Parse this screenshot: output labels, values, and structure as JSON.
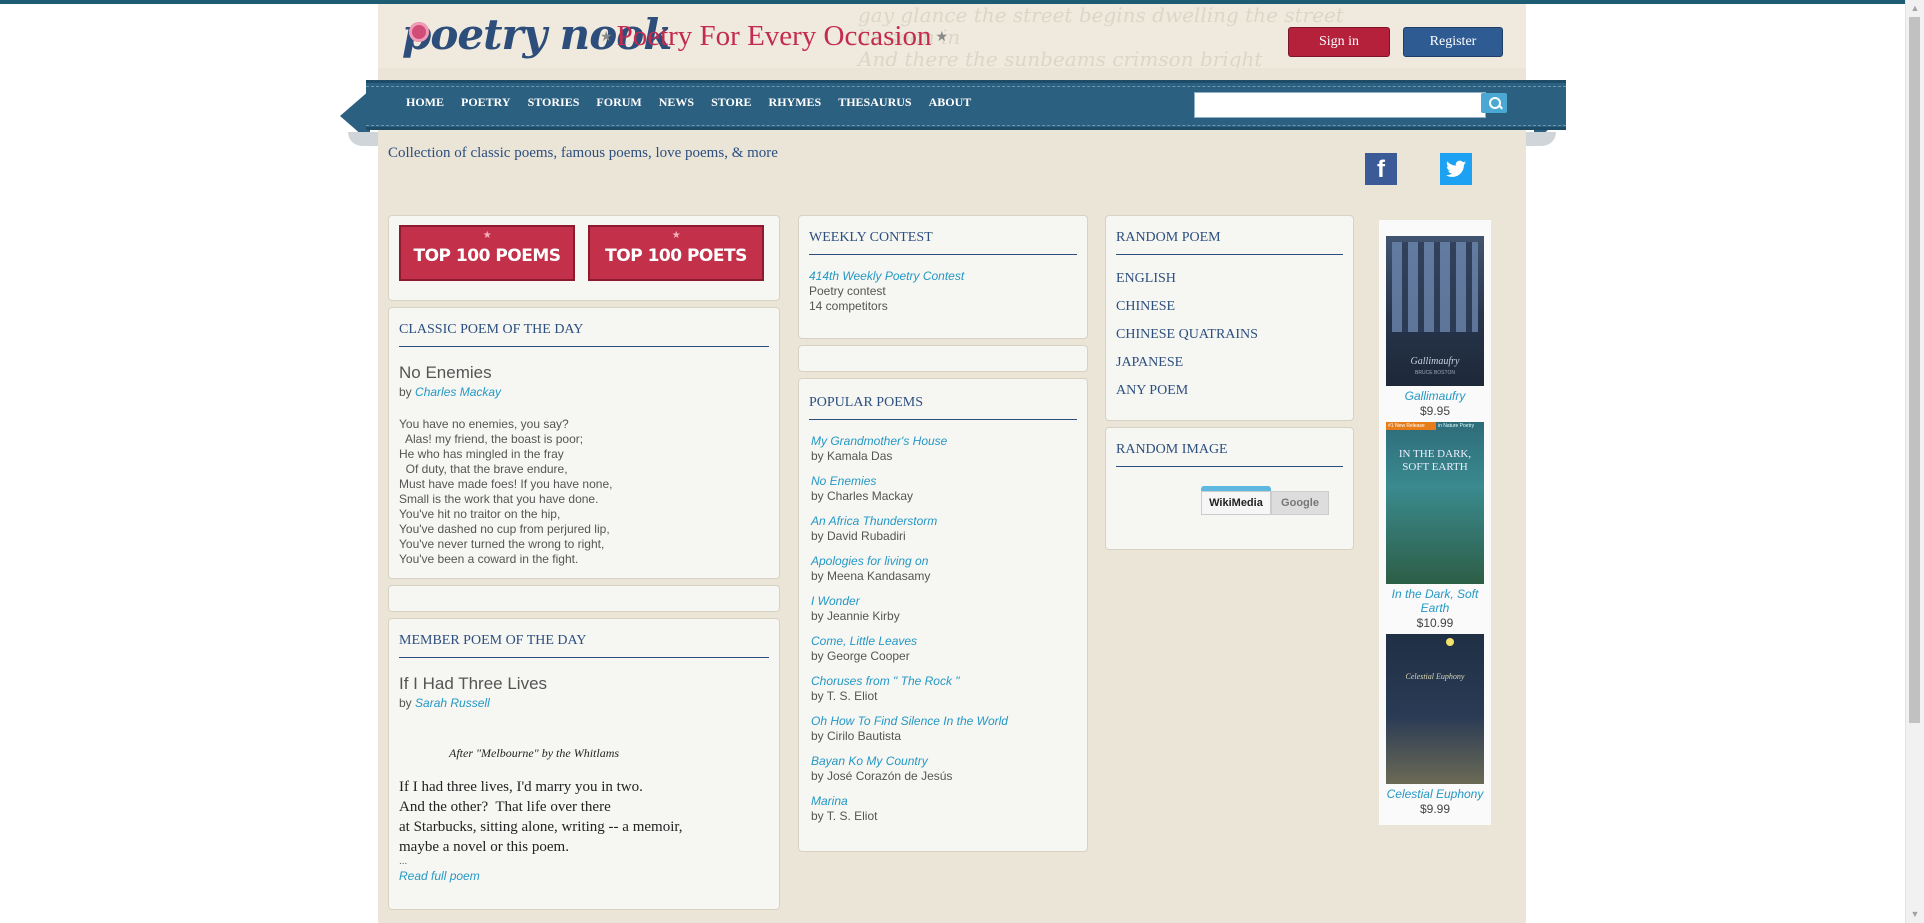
{
  "header": {
    "logo": "poetry nook",
    "tagline": "Poetry For Every Occasion",
    "sign_in": "Sign in",
    "register": "Register"
  },
  "nav": {
    "items": [
      "HOME",
      "POETRY",
      "STORIES",
      "FORUM",
      "NEWS",
      "STORE",
      "RHYMES",
      "THESAURUS",
      "ABOUT"
    ],
    "search_placeholder": ""
  },
  "subtitle": "Collection of classic poems, famous poems, love poems, & more",
  "social": {
    "facebook": "f",
    "twitter": "🐦"
  },
  "top_buttons": {
    "poems": "TOP 100 POEMS",
    "poets": "TOP 100 POETS"
  },
  "classic": {
    "heading": "CLASSIC POEM OF THE DAY",
    "title": "No Enemies",
    "by_prefix": "by",
    "author": "Charles Mackay",
    "lines": "You have no enemies, you say?\n  Alas! my friend, the boast is poor;\nHe who has mingled in the fray\n  Of duty, that the brave endure,\nMust have made foes! If you have none,\nSmall is the work that you have done.\nYou've hit no traitor on the hip,\nYou've dashed no cup from perjured lip,\nYou've never turned the wrong to right,\nYou've been a coward in the fight."
  },
  "member": {
    "heading": "MEMBER POEM OF THE DAY",
    "title": "If I Had Three Lives",
    "by_prefix": "by",
    "author": "Sarah Russell",
    "epigraph": "After \"Melbourne\" by the Whitlams",
    "lines": "If I had three lives, I'd marry you in two.\nAnd the other?  That life over there\nat Starbucks, sitting alone, writing -- a memoir,\nmaybe a novel or this poem.",
    "ellipsis": "...",
    "read_more": "Read full poem"
  },
  "contest": {
    "heading": "WEEKLY CONTEST",
    "link": "414th Weekly Poetry Contest",
    "type": "Poetry contest",
    "competitors": "14 competitors"
  },
  "popular": {
    "heading": "POPULAR POEMS",
    "items": [
      {
        "title": "My Grandmother's House",
        "author": "by Kamala Das"
      },
      {
        "title": "No Enemies",
        "author": "by Charles Mackay"
      },
      {
        "title": "An Africa Thunderstorm",
        "author": "by David Rubadiri"
      },
      {
        "title": "Apologies for living on",
        "author": "by Meena Kandasamy"
      },
      {
        "title": "I Wonder",
        "author": "by Jeannie Kirby"
      },
      {
        "title": "Come, Little Leaves",
        "author": "by George Cooper"
      },
      {
        "title": "Choruses from \" The Rock \"",
        "author": "by T. S. Eliot"
      },
      {
        "title": "Oh How To Find Silence In the World",
        "author": "by Cirilo Bautista"
      },
      {
        "title": "Bayan Ko My Country",
        "author": "by José Corazón de Jesús"
      },
      {
        "title": "Marina",
        "author": "by T. S. Eliot"
      }
    ]
  },
  "random_poem": {
    "heading": "RANDOM POEM",
    "links": [
      "ENGLISH",
      "CHINESE",
      "CHINESE QUATRAINS",
      "JAPANESE",
      "ANY POEM"
    ]
  },
  "random_image": {
    "heading": "RANDOM IMAGE",
    "tabs": [
      "WikiMedia",
      "Google"
    ]
  },
  "books": [
    {
      "title": "Gallimaufry",
      "price": "$9.95",
      "cover_text": "Gallimaufry",
      "cover_author": "BRUCE BOSTON"
    },
    {
      "title": "In the Dark, Soft Earth",
      "price": "$10.99",
      "cover_text": "IN THE DARK, SOFT EARTH",
      "badge": "#1 New Release",
      "badge2": "in Nature Poetry"
    },
    {
      "title": "Celestial Euphony",
      "price": "$9.99",
      "cover_text": "Celestial Euphony"
    }
  ],
  "colors": {
    "navy": "#2c4f7f",
    "nav_bg": "#2b6080",
    "red": "#b5203b",
    "link": "#2598c4",
    "page_bg": "#ebe5d7"
  }
}
